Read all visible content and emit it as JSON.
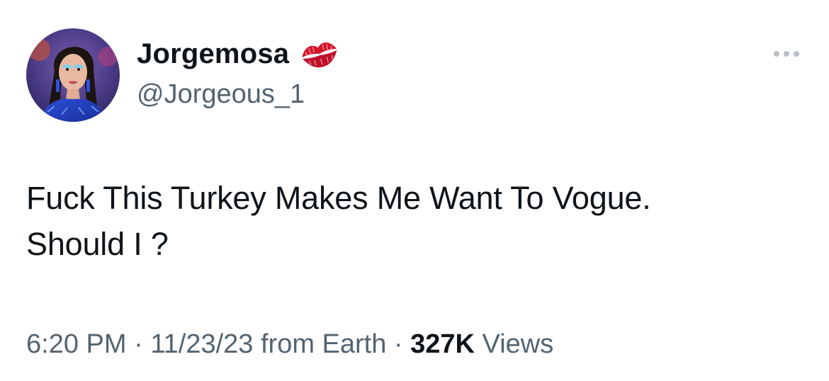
{
  "user": {
    "display_name": "Jorgemosa",
    "handle": "@Jorgeous_1",
    "badge_icon": "kiss-lips-icon"
  },
  "menu": {
    "more_icon": "more-horizontal-icon"
  },
  "tweet": {
    "line1": "Fuck This Turkey Makes Me Want To Vogue.",
    "line2": "Should I ?"
  },
  "meta": {
    "time": "6:20 PM",
    "separator1": " · ",
    "date": "11/23/23",
    "source": " from Earth",
    "separator2": " · ",
    "views_count": "327K",
    "views_label": " Views"
  },
  "colors": {
    "text": "#0f1419",
    "secondary": "#536471",
    "lips": "#d4142b",
    "more_dots": "#b8c1c9"
  }
}
